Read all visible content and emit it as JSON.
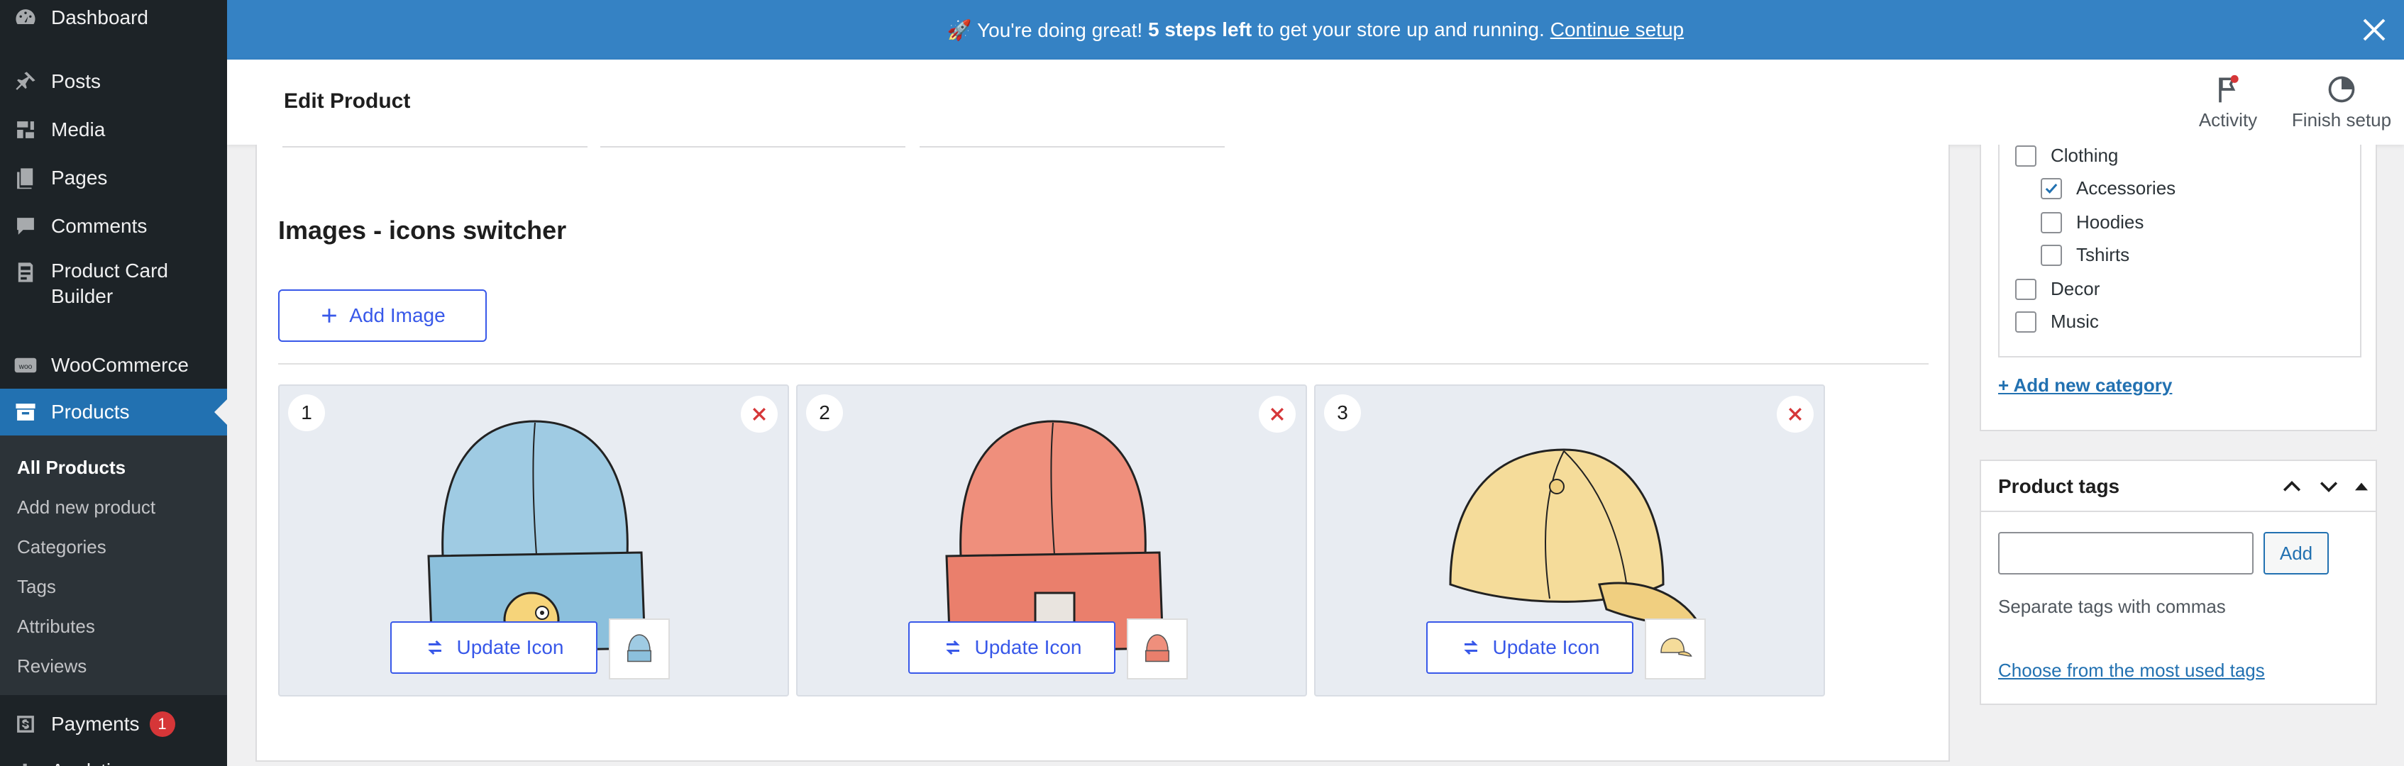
{
  "sidebar": {
    "items": [
      {
        "label": "Dashboard"
      },
      {
        "label": "Posts"
      },
      {
        "label": "Media"
      },
      {
        "label": "Pages"
      },
      {
        "label": "Comments"
      },
      {
        "label": "Product Card Builder"
      },
      {
        "label": "WooCommerce"
      },
      {
        "label": "Products"
      },
      {
        "label": "Payments",
        "badge": "1"
      },
      {
        "label": "Analytics"
      }
    ],
    "submenu": [
      "All Products",
      "Add new product",
      "Categories",
      "Tags",
      "Attributes",
      "Reviews"
    ],
    "colors": {
      "bg": "#1d2327",
      "active": "#2271b1"
    }
  },
  "notice": {
    "prefix": "🚀 You're doing great! ",
    "bold": "5 steps left",
    "middle": " to get your store up and running.",
    "link": "Continue setup"
  },
  "header": {
    "title": "Edit Product",
    "activity": "Activity",
    "finish_setup": "Finish setup"
  },
  "main": {
    "section_title": "Images - icons switcher",
    "add_image": "Add Image",
    "cards": [
      {
        "number": "1",
        "item": "blue beanie",
        "update_label": "Update Icon",
        "color": "#9fcbe3"
      },
      {
        "number": "2",
        "item": "red beanie",
        "update_label": "Update Icon",
        "color": "#ef8f7c"
      },
      {
        "number": "3",
        "item": "yellow cap",
        "update_label": "Update Icon",
        "color": "#f5dc9a"
      }
    ]
  },
  "categories": {
    "items": [
      {
        "label": "Clothing",
        "checked": false,
        "indent": false
      },
      {
        "label": "Accessories",
        "checked": true,
        "indent": true
      },
      {
        "label": "Hoodies",
        "checked": false,
        "indent": true
      },
      {
        "label": "Tshirts",
        "checked": false,
        "indent": true
      },
      {
        "label": "Decor",
        "checked": false,
        "indent": false
      },
      {
        "label": "Music",
        "checked": false,
        "indent": false
      }
    ],
    "add_new": "+ Add new category"
  },
  "tags": {
    "title": "Product tags",
    "input_value": "",
    "add": "Add",
    "help": "Separate tags with commas",
    "choose": "Choose from the most used tags"
  }
}
